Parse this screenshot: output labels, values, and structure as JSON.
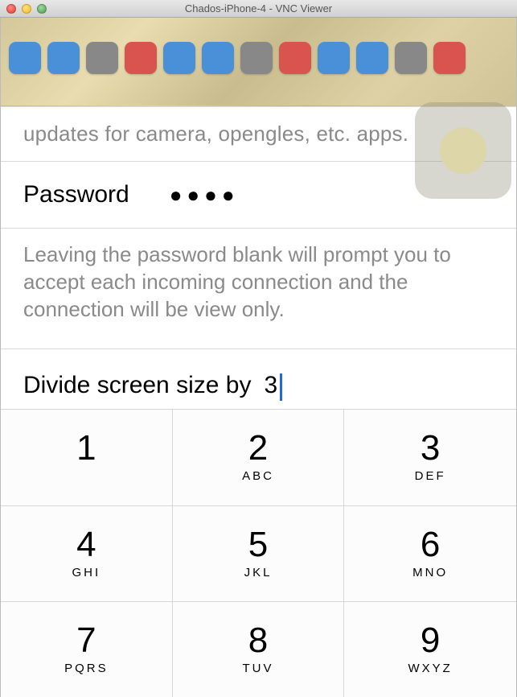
{
  "window": {
    "title": "Chados-iPhone-4 - VNC Viewer"
  },
  "updates_line": "updates for camera, opengles, etc. apps.",
  "password": {
    "label": "Password",
    "masked": "●●●●"
  },
  "helper": "Leaving the password blank will prompt you to accept each incoming connection and the connection will be view only.",
  "divide": {
    "label": "Divide screen size by",
    "value": "3"
  },
  "keypad": [
    {
      "digit": "1",
      "letters": ""
    },
    {
      "digit": "2",
      "letters": "ABC"
    },
    {
      "digit": "3",
      "letters": "DEF"
    },
    {
      "digit": "4",
      "letters": "GHI"
    },
    {
      "digit": "5",
      "letters": "JKL"
    },
    {
      "digit": "6",
      "letters": "MNO"
    },
    {
      "digit": "7",
      "letters": "PQRS"
    },
    {
      "digit": "8",
      "letters": "TUV"
    },
    {
      "digit": "9",
      "letters": "WXYZ"
    }
  ],
  "app_icons": [
    {
      "color": "#4a90d9"
    },
    {
      "color": "#4a90d9"
    },
    {
      "color": "#888"
    },
    {
      "color": "#d9534f"
    },
    {
      "color": "#4a90d9"
    },
    {
      "color": "#4a90d9"
    },
    {
      "color": "#888"
    },
    {
      "color": "#d9534f"
    },
    {
      "color": "#4a90d9"
    },
    {
      "color": "#4a90d9"
    },
    {
      "color": "#888"
    },
    {
      "color": "#d9534f"
    }
  ]
}
